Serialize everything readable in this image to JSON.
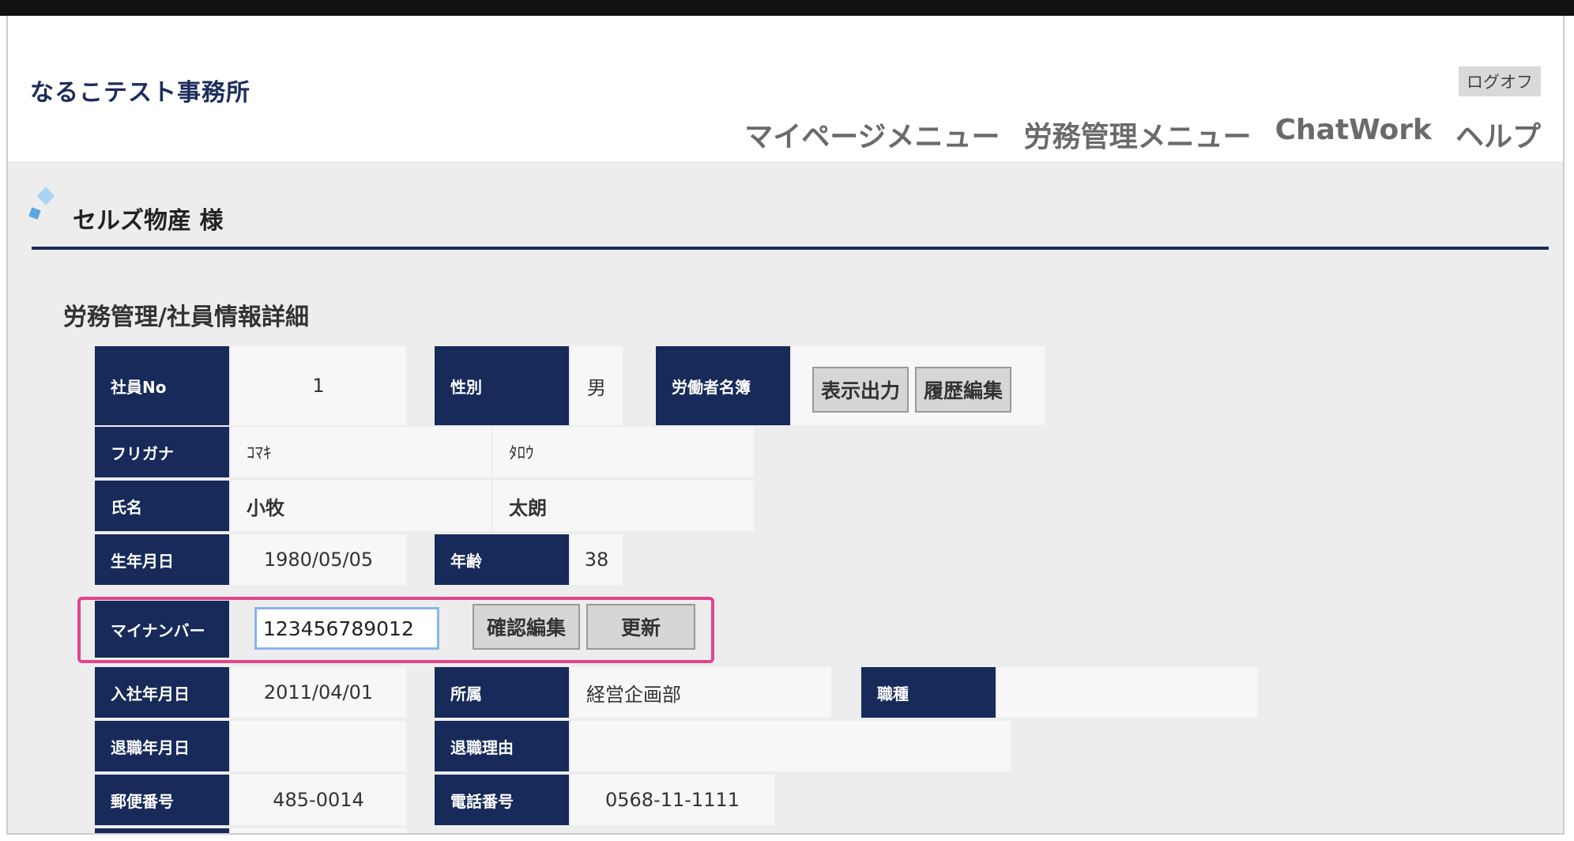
{
  "header": {
    "office_name": "なるこテスト事務所",
    "logoff_label": "ログオフ",
    "nav": [
      {
        "label": "マイページメニュー"
      },
      {
        "label": "労務管理メニュー"
      },
      {
        "label": "ChatWork"
      },
      {
        "label": "ヘルプ"
      }
    ]
  },
  "company": {
    "name": "セルズ物産 様"
  },
  "section_title": "労務管理/社員情報詳細",
  "employee": {
    "employee_no_label": "社員No",
    "employee_no": "1",
    "gender_label": "性別",
    "gender": "男",
    "register_label": "労働者名簿",
    "display_output_button": "表示出力",
    "history_edit_button": "履歴編集",
    "furigana_label": "フリガナ",
    "furigana_last": "ｺﾏｷ",
    "furigana_first": "ﾀﾛｳ",
    "name_label": "氏名",
    "name_last": "小牧",
    "name_first": "太朗",
    "birthdate_label": "生年月日",
    "birthdate": "1980/05/05",
    "age_label": "年齢",
    "age": "38",
    "my_number_label": "マイナンバー",
    "my_number": "123456789012",
    "confirm_edit_button": "確認編集",
    "update_button": "更新",
    "hire_date_label": "入社年月日",
    "hire_date": "2011/04/01",
    "department_label": "所属",
    "department": "経営企画部",
    "job_type_label": "職種",
    "job_type": "",
    "retire_date_label": "退職年月日",
    "retire_date": "",
    "retire_reason_label": "退職理由",
    "retire_reason": "",
    "postal_label": "郵便番号",
    "postal": "485-0014",
    "phone_label": "電話番号",
    "phone": "0568-11-1111"
  },
  "colors": {
    "navy": "#172a5a",
    "highlight": "#e0458c",
    "background": "#ededed"
  }
}
